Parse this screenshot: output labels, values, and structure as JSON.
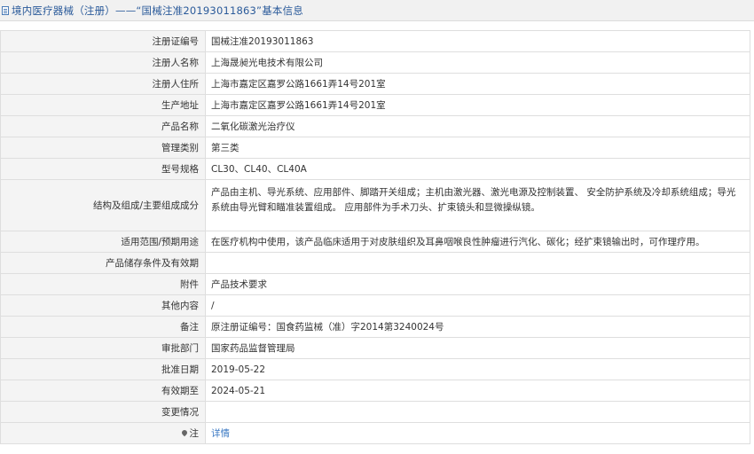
{
  "header": {
    "title": "境内医疗器械（注册）——“国械注准20193011863”基本信息"
  },
  "rows": [
    {
      "label": "注册证编号",
      "value": "国械注准20193011863"
    },
    {
      "label": "注册人名称",
      "value": "上海晟昶光电技术有限公司"
    },
    {
      "label": "注册人住所",
      "value": "上海市嘉定区嘉罗公路1661弄14号201室"
    },
    {
      "label": "生产地址",
      "value": "上海市嘉定区嘉罗公路1661弄14号201室"
    },
    {
      "label": "产品名称",
      "value": "二氧化碳激光治疗仪"
    },
    {
      "label": "管理类别",
      "value": "第三类"
    },
    {
      "label": "型号规格",
      "value": "CL30、CL40、CL40A"
    },
    {
      "label": "结构及组成/主要组成成分",
      "value": "产品由主机、导光系统、应用部件、脚踏开关组成；主机由激光器、激光电源及控制装置、 安全防护系统及冷却系统组成；导光系统由导光臂和瞄准装置组成。 应用部件为手术刀头、扩束镜头和显微操纵镜。"
    },
    {
      "label": "适用范围/预期用途",
      "value": "在医疗机构中使用，该产品临床适用于对皮肤组织及耳鼻咽喉良性肿瘤进行汽化、碳化；经扩束镜输出时，可作理疗用。"
    },
    {
      "label": "产品储存条件及有效期",
      "value": ""
    },
    {
      "label": "附件",
      "value": "产品技术要求"
    },
    {
      "label": "其他内容",
      "value": "/"
    },
    {
      "label": "备注",
      "value": "原注册证编号：国食药监械（准）字2014第3240024号"
    },
    {
      "label": "审批部门",
      "value": "国家药品监督管理局"
    },
    {
      "label": "批准日期",
      "value": "2019-05-22"
    },
    {
      "label": "有效期至",
      "value": "2024-05-21"
    },
    {
      "label": "变更情况",
      "value": ""
    },
    {
      "label": "注",
      "value": "详情"
    }
  ]
}
